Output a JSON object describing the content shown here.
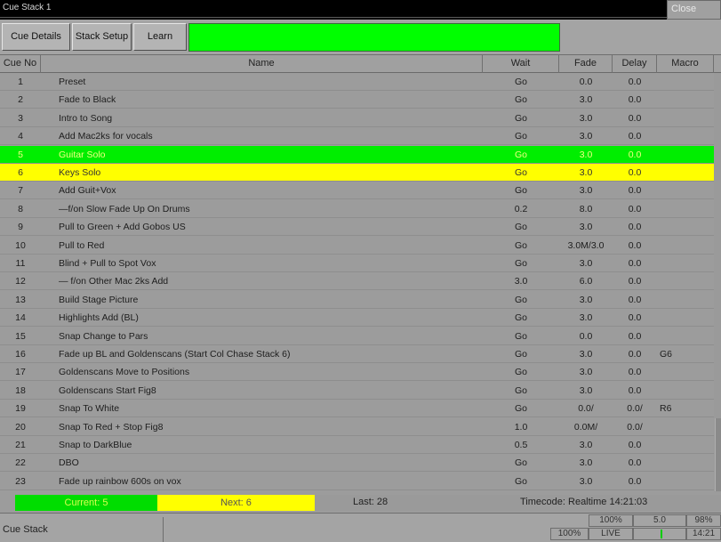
{
  "window": {
    "title": "Cue Stack 1",
    "close_label": "Close"
  },
  "toolbar": {
    "cue_details_label": "Cue Details",
    "stack_setup_label": "Stack Setup",
    "learn_label": "Learn"
  },
  "columns": {
    "cue_no": "Cue No",
    "name": "Name",
    "wait": "Wait",
    "fade": "Fade",
    "delay": "Delay",
    "macro": "Macro"
  },
  "rows": [
    {
      "no": "1",
      "name": "Preset",
      "wait": "Go",
      "fade": "0.0",
      "delay": "0.0",
      "macro": ""
    },
    {
      "no": "2",
      "name": "Fade to Black",
      "wait": "Go",
      "fade": "3.0",
      "delay": "0.0",
      "macro": ""
    },
    {
      "no": "3",
      "name": "Intro to Song",
      "wait": "Go",
      "fade": "3.0",
      "delay": "0.0",
      "macro": ""
    },
    {
      "no": "4",
      "name": "Add Mac2ks for vocals",
      "wait": "Go",
      "fade": "3.0",
      "delay": "0.0",
      "macro": ""
    },
    {
      "no": "5",
      "name": "Guitar Solo",
      "wait": "Go",
      "fade": "3.0",
      "delay": "0.0",
      "macro": ""
    },
    {
      "no": "6",
      "name": "Keys Solo",
      "wait": "Go",
      "fade": "3.0",
      "delay": "0.0",
      "macro": ""
    },
    {
      "no": "7",
      "name": "Add Guit+Vox",
      "wait": "Go",
      "fade": "3.0",
      "delay": "0.0",
      "macro": ""
    },
    {
      "no": "8",
      "name": "—f/on Slow Fade Up On Drums",
      "wait": "0.2",
      "fade": "8.0",
      "delay": "0.0",
      "macro": ""
    },
    {
      "no": "9",
      "name": "Pull to Green + Add Gobos US",
      "wait": "Go",
      "fade": "3.0",
      "delay": "0.0",
      "macro": ""
    },
    {
      "no": "10",
      "name": "Pull to Red",
      "wait": "Go",
      "fade": "3.0M/3.0",
      "delay": "0.0",
      "macro": ""
    },
    {
      "no": "11",
      "name": "Blind + Pull to Spot Vox",
      "wait": "Go",
      "fade": "3.0",
      "delay": "0.0",
      "macro": ""
    },
    {
      "no": "12",
      "name": "— f/on Other Mac 2ks Add",
      "wait": "3.0",
      "fade": "6.0",
      "delay": "0.0",
      "macro": ""
    },
    {
      "no": "13",
      "name": "Build Stage Picture",
      "wait": "Go",
      "fade": "3.0",
      "delay": "0.0",
      "macro": ""
    },
    {
      "no": "14",
      "name": "Highlights Add (BL)",
      "wait": "Go",
      "fade": "3.0",
      "delay": "0.0",
      "macro": ""
    },
    {
      "no": "15",
      "name": "Snap Change to Pars",
      "wait": "Go",
      "fade": "0.0",
      "delay": "0.0",
      "macro": ""
    },
    {
      "no": "16",
      "name": "Fade up BL and Goldenscans (Start Col Chase Stack 6)",
      "wait": "Go",
      "fade": "3.0",
      "delay": "0.0",
      "macro": "G6"
    },
    {
      "no": "17",
      "name": "Goldenscans Move to Positions",
      "wait": "Go",
      "fade": "3.0",
      "delay": "0.0",
      "macro": ""
    },
    {
      "no": "18",
      "name": "Goldenscans Start Fig8",
      "wait": "Go",
      "fade": "3.0",
      "delay": "0.0",
      "macro": ""
    },
    {
      "no": "19",
      "name": "Snap To White",
      "wait": "Go",
      "fade": "0.0/",
      "delay": "0.0/",
      "macro": "R6"
    },
    {
      "no": "20",
      "name": "Snap To Red + Stop Fig8",
      "wait": "1.0",
      "fade": "0.0M/",
      "delay": "0.0/",
      "macro": ""
    },
    {
      "no": "21",
      "name": "Snap to DarkBlue",
      "wait": "0.5",
      "fade": "3.0",
      "delay": "0.0",
      "macro": ""
    },
    {
      "no": "22",
      "name": "DBO",
      "wait": "Go",
      "fade": "3.0",
      "delay": "0.0",
      "macro": ""
    },
    {
      "no": "23",
      "name": "Fade up rainbow 600s on vox",
      "wait": "Go",
      "fade": "3.0",
      "delay": "0.0",
      "macro": ""
    }
  ],
  "status": {
    "current": "Current: 5",
    "next": "Next: 6",
    "last": "Last: 28",
    "timecode": "Timecode: Realtime 14:21:03"
  },
  "bottom": {
    "label": "Cue Stack",
    "percent_top": "100%",
    "percent_bottom": "100%",
    "mode": "LIVE",
    "value_top": "5.0",
    "master_top": "98%",
    "clock": "14:21"
  },
  "colors": {
    "current_row": "#00ee00",
    "next_row": "#ffff00",
    "background": "#9c9c9c"
  }
}
